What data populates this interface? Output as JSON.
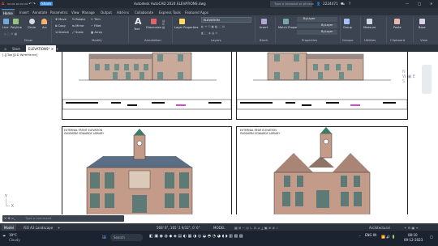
{
  "window": {
    "title": "Autodesk AutoCAD 2024   ELEVATIONS.dwg",
    "search_placeholder": "Type a keyword or phrase",
    "user": "2224471",
    "share_label": "Share"
  },
  "ribbon_tabs": [
    "Home",
    "Insert",
    "Annotate",
    "Parametric",
    "View",
    "Manage",
    "Output",
    "Add-ins",
    "Collaborate",
    "Express Tools",
    "Featured Apps"
  ],
  "ribbon": {
    "draw_tools": [
      "Line",
      "Polyline",
      "Circle",
      "Arc"
    ],
    "modify_tools": [
      "Move",
      "Rotate",
      "Trim",
      "Copy",
      "Mirror",
      "Fillet",
      "Stretch",
      "Scale",
      "Array"
    ],
    "annotation_tools": [
      "Text",
      "Dimension"
    ],
    "layer_tools": [
      "Layer Properties"
    ],
    "layer_current": "ELEVATION",
    "block_tools": [
      "Insert"
    ],
    "properties_tools": [
      "Match Properties"
    ],
    "bylayer_1": "ByLayer",
    "bylayer_2": "ByLayer",
    "bylayer_3": "ByLayer",
    "group_tools": [
      "Group"
    ],
    "utilities_tools": [
      "Measure"
    ],
    "clipboard_tools": [
      "Paste"
    ],
    "view_tools": [
      "Base"
    ],
    "panels": [
      "Draw",
      "Modify",
      "Annotation",
      "Layers",
      "Block",
      "Properties",
      "Groups",
      "Utilities",
      "Clipboard",
      "View"
    ]
  },
  "file_tabs": [
    "Start",
    "ELEVATIONS*"
  ],
  "drawing": {
    "view_controls": "[-][Top][2D Wireframe]",
    "sheet_left_caption": "EXTERNAL FRONT ELEVATION",
    "sheet_left_title": "PASSMORE EDWARDS LIBRARY",
    "sheet_right_caption": "EXTERNAL REAR ELEVATION",
    "sheet_right_title": "PASSMORE EDWARDS LIBRARY"
  },
  "command_line": {
    "placeholder": "Type a command"
  },
  "layout_tabs": [
    "Model",
    "ISO A3 Landscape"
  ],
  "status_bar": {
    "coords": "568' 6\", 165' 2 9/32\", 0' 0\"",
    "annotation": "Architectural",
    "model": "MODEL"
  },
  "taskbar": {
    "weather_temp": "19°C",
    "weather_desc": "Cloudy",
    "search_label": "Search",
    "language": "ENG IN",
    "time": "08:10",
    "date": "09-12-2023"
  },
  "colors": {
    "accent": "#3a8ee6",
    "ribbon_bg": "#3b4450",
    "dark_bg": "#2b323c",
    "taskbar_bg": "#1b2330"
  }
}
